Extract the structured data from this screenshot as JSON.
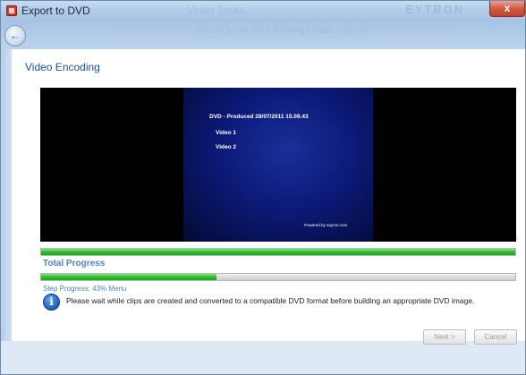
{
  "window": {
    "title": "Export to DVD",
    "ghost_title": "Video Tasks",
    "ghost_subtitle": "Convert to one of the following formats or device.",
    "brand_text": "EYTRON",
    "close_label": "x"
  },
  "nav": {
    "back_glyph": "←"
  },
  "page": {
    "title": "Video Encoding"
  },
  "preview": {
    "menu_title": "DVD - Produced 28/07/2011 15.09.43",
    "menu_items": [
      "Video 1",
      "Video 2"
    ],
    "footer_text": "Powered by sayron.com"
  },
  "progress": {
    "total_label": "Total Progress",
    "total_fraction": 1.0,
    "step_label": "Step Progress: 43% Menu",
    "step_fraction": 0.37
  },
  "message": {
    "icon": "info-icon",
    "text": "Please wait while clips are created and converted to a compatible DVD format before building an appropriate DVD image."
  },
  "buttons": {
    "next_label": "Next >",
    "cancel_label": "Cancel"
  },
  "colors": {
    "accent_title": "#1d4f91",
    "progress_label": "#4a86c5",
    "progress_green": "#2fc42f",
    "menu_background": "#0c1a78"
  }
}
